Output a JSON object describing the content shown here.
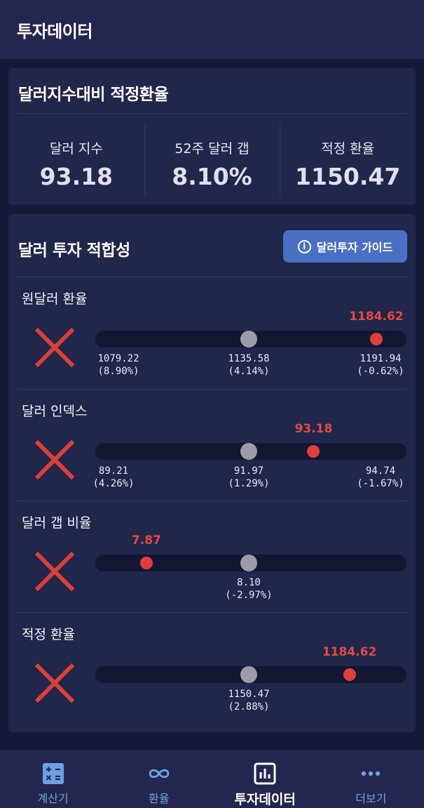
{
  "header": {
    "title": "투자데이터"
  },
  "fair_rate": {
    "title": "달러지수대비 적정환율",
    "metrics": [
      {
        "label": "달러 지수",
        "value": "93.18"
      },
      {
        "label": "52주 달러 갭",
        "value": "8.10%"
      },
      {
        "label": "적정 환율",
        "value": "1150.47"
      }
    ]
  },
  "suitability": {
    "title": "달러 투자 적합성",
    "guide_button": "달러투자 가이드",
    "sections": [
      {
        "label": "원달러 환율",
        "status_icon": "x-icon",
        "current": "1184.62",
        "current_fraction": 0.92,
        "ticks": [
          {
            "value": "1079.22",
            "pct": "(8.90%)"
          },
          {
            "value": "1135.58",
            "pct": "(4.14%)"
          },
          {
            "value": "1191.94",
            "pct": "(-0.62%)"
          }
        ]
      },
      {
        "label": "달러 인덱스",
        "status_icon": "x-icon",
        "current": "93.18",
        "current_fraction": 0.71,
        "ticks": [
          {
            "value": "89.21",
            "pct": "(4.26%)"
          },
          {
            "value": "91.97",
            "pct": "(1.29%)"
          },
          {
            "value": "94.74",
            "pct": "(-1.67%)"
          }
        ]
      },
      {
        "label": "달러 갭 비율",
        "status_icon": "x-icon",
        "current": "7.87",
        "current_fraction": 0.15,
        "ticks": [
          {
            "value": "8.10",
            "pct": "(-2.97%)"
          }
        ]
      },
      {
        "label": "적정 환율",
        "status_icon": "x-icon",
        "current": "1184.62",
        "current_fraction": 0.83,
        "ticks": [
          {
            "value": "1150.47",
            "pct": "(2.88%)"
          }
        ]
      }
    ]
  },
  "tabs": [
    {
      "label": "계산기",
      "icon": "calculator-icon",
      "active": false
    },
    {
      "label": "환율",
      "icon": "infinity-icon",
      "active": false
    },
    {
      "label": "투자데이터",
      "icon": "chart-icon",
      "active": true
    },
    {
      "label": "더보기",
      "icon": "more-icon",
      "active": false
    }
  ],
  "colors": {
    "background": "#161937",
    "card": "#21264b",
    "accent_blue": "#4b6fc2",
    "alert_red": "#e03e3a",
    "neutral_dot": "#9a9ca8"
  }
}
